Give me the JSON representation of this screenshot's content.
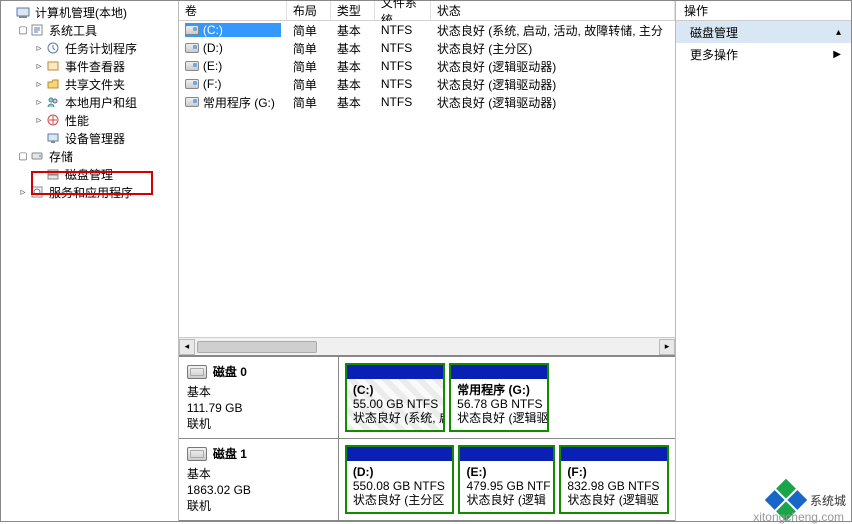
{
  "tree": {
    "root": "计算机管理(本地)",
    "system_tools": "系统工具",
    "task_sched": "任务计划程序",
    "event_viewer": "事件查看器",
    "shared": "共享文件夹",
    "users": "本地用户和组",
    "perf": "性能",
    "devmgr": "设备管理器",
    "storage": "存储",
    "diskmgmt": "磁盘管理",
    "services": "服务和应用程序"
  },
  "columns": {
    "vol": "卷",
    "layout": "布局",
    "type": "类型",
    "fs": "文件系统",
    "status": "状态"
  },
  "volumes": [
    {
      "name": "(C:)",
      "layout": "简单",
      "type": "基本",
      "fs": "NTFS",
      "status": "状态良好 (系统, 启动, 活动, 故障转储, 主分"
    },
    {
      "name": "(D:)",
      "layout": "简单",
      "type": "基本",
      "fs": "NTFS",
      "status": "状态良好 (主分区)"
    },
    {
      "name": "(E:)",
      "layout": "简单",
      "type": "基本",
      "fs": "NTFS",
      "status": "状态良好 (逻辑驱动器)"
    },
    {
      "name": "(F:)",
      "layout": "简单",
      "type": "基本",
      "fs": "NTFS",
      "status": "状态良好 (逻辑驱动器)"
    },
    {
      "name": "常用程序 (G:)",
      "layout": "简单",
      "type": "基本",
      "fs": "NTFS",
      "status": "状态良好 (逻辑驱动器)"
    }
  ],
  "disks": [
    {
      "title": "磁盘 0",
      "kind": "基本",
      "size": "111.79 GB",
      "state": "联机",
      "parts": [
        {
          "name": "(C:)",
          "size": "55.00 GB NTFS",
          "status": "状态良好 (系统, 启动,",
          "hatched": true
        },
        {
          "name": "常用程序  (G:)",
          "size": "56.78 GB NTFS",
          "status": "状态良好 (逻辑驱动",
          "hatched": false
        }
      ]
    },
    {
      "title": "磁盘 1",
      "kind": "基本",
      "size": "1863.02 GB",
      "state": "联机",
      "parts": [
        {
          "name": "(D:)",
          "size": "550.08 GB NTFS",
          "status": "状态良好 (主分区",
          "hatched": false
        },
        {
          "name": "(E:)",
          "size": "479.95 GB NTF",
          "status": "状态良好 (逻辑",
          "hatched": false
        },
        {
          "name": "(F:)",
          "size": "832.98 GB NTFS",
          "status": "状态良好 (逻辑驱",
          "hatched": false
        }
      ]
    }
  ],
  "actions": {
    "header": "操作",
    "diskmgmt": "磁盘管理",
    "more": "更多操作"
  },
  "watermark": {
    "text": "系统城",
    "url": "xitongcheng.com"
  }
}
